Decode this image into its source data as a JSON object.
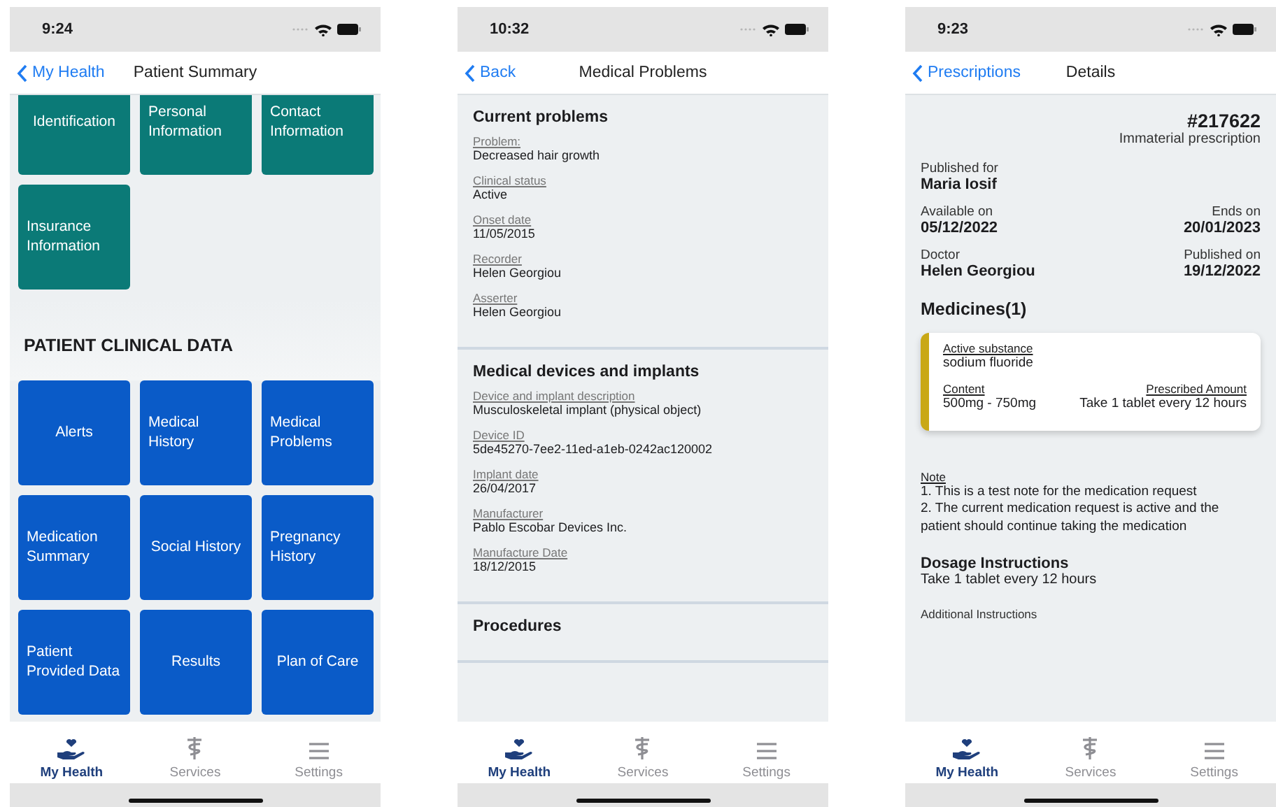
{
  "phones": [
    {
      "kind": "tiles",
      "status_time": "9:24",
      "nav": {
        "back": "My Health",
        "title": "Patient Summary"
      },
      "groups": [
        {
          "color": "#0b7a77",
          "tiles": [
            "Identification",
            "Personal Information",
            "Contact Information",
            "Insurance Information"
          ]
        },
        {
          "title": "PATIENT CLINICAL DATA",
          "color": "#0a5bc8",
          "tiles": [
            "Alerts",
            "Medical History",
            "Medical Problems",
            "Medication Summary",
            "Social History",
            "Pregnancy History",
            "Patient Provided Data",
            "Results",
            "Plan of Care"
          ]
        }
      ],
      "tab_bar": [
        {
          "label": "My Health",
          "selected": true
        },
        {
          "label": "Services",
          "selected": false
        },
        {
          "label": "Settings",
          "selected": false
        }
      ]
    },
    {
      "kind": "problems",
      "status_time": "10:32",
      "nav": {
        "back": "Back",
        "title": "Medical Problems"
      },
      "sections": [
        {
          "title": "Current problems",
          "fields": [
            {
              "label": "Problem:",
              "value": "Decreased hair growth"
            },
            {
              "label": "Clinical status",
              "value": "Active"
            },
            {
              "label": "Onset date",
              "value": "11/05/2015"
            },
            {
              "label": "Recorder",
              "value": "Helen Georgiou"
            },
            {
              "label": "Asserter",
              "value": "Helen Georgiou"
            }
          ]
        },
        {
          "title": "Medical devices and implants",
          "fields": [
            {
              "label": "Device and implant description",
              "value": "Musculoskeletal implant (physical object)"
            },
            {
              "label": "Device ID",
              "value": "5de45270-7ee2-11ed-a1eb-0242ac120002"
            },
            {
              "label": "Implant date",
              "value": "26/04/2017"
            },
            {
              "label": "Manufacturer",
              "value": "Pablo Escobar Devices Inc."
            },
            {
              "label": "Manufacture Date",
              "value": "18/12/2015"
            }
          ]
        },
        {
          "title": "Procedures"
        }
      ],
      "tab_bar": [
        {
          "label": "My Health",
          "selected": true
        },
        {
          "label": "Services",
          "selected": false
        },
        {
          "label": "Settings",
          "selected": false
        }
      ]
    },
    {
      "kind": "prescription",
      "status_time": "9:23",
      "nav": {
        "back": "Prescriptions",
        "title": "Details"
      },
      "number": "#217622",
      "type": "Immaterial prescription",
      "info_rows": [
        {
          "left": {
            "label": "Published for",
            "value": "Maria Iosif"
          }
        },
        {
          "left": {
            "label": "Available on",
            "value": "05/12/2022"
          },
          "right": {
            "label": "Ends on",
            "value": "20/01/2023"
          }
        },
        {
          "left": {
            "label": "Doctor",
            "value": "Helen Georgiou"
          },
          "right": {
            "label": "Published on",
            "value": "19/12/2022"
          }
        }
      ],
      "medicines_title": "Medicines(1)",
      "medicine": {
        "substance_label": "Active substance",
        "substance": "sodium fluoride",
        "content_label": "Content",
        "content": "500mg - 750mg",
        "amount_label": "Prescribed Amount",
        "amount": "Take 1 tablet every 12 hours"
      },
      "note": {
        "label": "Note",
        "lines": [
          "1. This is a test note for the medication request",
          "2. The current medication request is active and the patient should continue taking the medication"
        ]
      },
      "dosage": {
        "title": "Dosage Instructions",
        "text": "Take 1 tablet every 12 hours"
      },
      "additional_label": "Additional Instructions",
      "tab_bar": [
        {
          "label": "My Health",
          "selected": true
        },
        {
          "label": "Services",
          "selected": false
        },
        {
          "label": "Settings",
          "selected": false
        }
      ]
    }
  ]
}
